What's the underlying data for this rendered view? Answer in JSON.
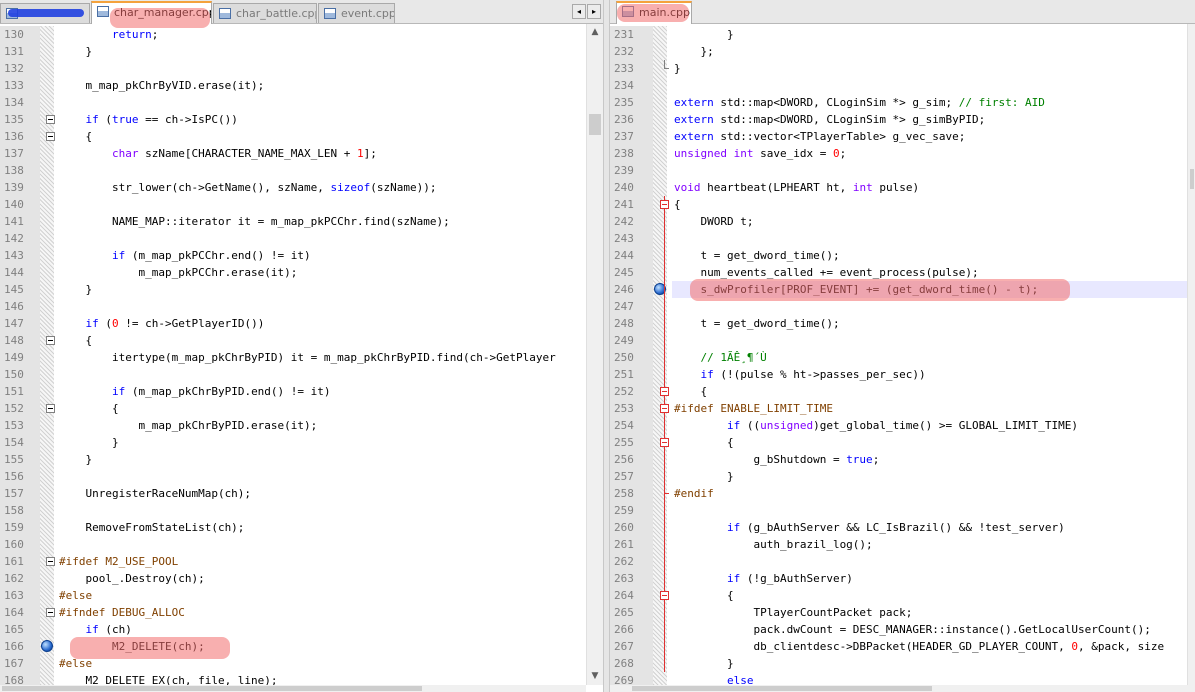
{
  "left_tabs": {
    "tab1": "",
    "tab2": "char_manager.cpp",
    "tab3": "char_battle.cpp",
    "tab4": "event.cpp",
    "nav_left": "◂",
    "nav_right": "▸",
    "close": "✕"
  },
  "right_tabs": {
    "tab1": "main.cpp"
  },
  "left_lines": [
    {
      "n": "130",
      "html": "        <span class=\"kw\">return</span>;"
    },
    {
      "n": "131",
      "html": "    }"
    },
    {
      "n": "132",
      "html": ""
    },
    {
      "n": "133",
      "html": "    m_map_pkChrByVID.erase(it);"
    },
    {
      "n": "134",
      "html": ""
    },
    {
      "n": "135",
      "html": "    <span class=\"kw\">if</span> (<span class=\"kw\">true</span> == ch->IsPC())"
    },
    {
      "n": "136",
      "html": "    {"
    },
    {
      "n": "137",
      "html": "        <span class=\"ty\">char</span> szName[CHARACTER_NAME_MAX_LEN + <span class=\"nm\">1</span>];"
    },
    {
      "n": "138",
      "html": ""
    },
    {
      "n": "139",
      "html": "        str_lower(ch->GetName(), szName, <span class=\"kw\">sizeof</span>(szName));"
    },
    {
      "n": "140",
      "html": ""
    },
    {
      "n": "141",
      "html": "        NAME_MAP::iterator it = m_map_pkPCChr.find(szName);"
    },
    {
      "n": "142",
      "html": ""
    },
    {
      "n": "143",
      "html": "        <span class=\"kw\">if</span> (m_map_pkPCChr.end() != it)"
    },
    {
      "n": "144",
      "html": "            m_map_pkPCChr.erase(it);"
    },
    {
      "n": "145",
      "html": "    }"
    },
    {
      "n": "146",
      "html": ""
    },
    {
      "n": "147",
      "html": "    <span class=\"kw\">if</span> (<span class=\"nm\">0</span> != ch->GetPlayerID())"
    },
    {
      "n": "148",
      "html": "    {"
    },
    {
      "n": "149",
      "html": "        itertype(m_map_pkChrByPID) it = m_map_pkChrByPID.find(ch->GetPlayer"
    },
    {
      "n": "150",
      "html": ""
    },
    {
      "n": "151",
      "html": "        <span class=\"kw\">if</span> (m_map_pkChrByPID.end() != it)"
    },
    {
      "n": "152",
      "html": "        {"
    },
    {
      "n": "153",
      "html": "            m_map_pkChrByPID.erase(it);"
    },
    {
      "n": "154",
      "html": "        }"
    },
    {
      "n": "155",
      "html": "    }"
    },
    {
      "n": "156",
      "html": ""
    },
    {
      "n": "157",
      "html": "    UnregisterRaceNumMap(ch);"
    },
    {
      "n": "158",
      "html": ""
    },
    {
      "n": "159",
      "html": "    RemoveFromStateList(ch);"
    },
    {
      "n": "160",
      "html": ""
    },
    {
      "n": "161",
      "html": "<span class=\"pp\">#ifdef M2_USE_POOL</span>"
    },
    {
      "n": "162",
      "html": "    pool_.Destroy(ch);"
    },
    {
      "n": "163",
      "html": "<span class=\"pp\">#else</span>"
    },
    {
      "n": "164",
      "html": "<span class=\"pp\">#ifndef DEBUG_ALLOC</span>"
    },
    {
      "n": "165",
      "html": "    <span class=\"kw\">if</span> (ch)"
    },
    {
      "n": "166",
      "html": "        M2_DELETE(ch);"
    },
    {
      "n": "167",
      "html": "<span class=\"pp\">#else</span>"
    },
    {
      "n": "168",
      "html": "    M2_DELETE_EX(ch, file, line);"
    }
  ],
  "right_lines": [
    {
      "n": "231",
      "html": "        }"
    },
    {
      "n": "232",
      "html": "    };"
    },
    {
      "n": "233",
      "html": "}"
    },
    {
      "n": "234",
      "html": ""
    },
    {
      "n": "235",
      "html": "<span class=\"kw\">extern</span> std::map&lt;DWORD, CLoginSim *&gt; g_sim; <span class=\"cm\">// first: AID</span>"
    },
    {
      "n": "236",
      "html": "<span class=\"kw\">extern</span> std::map&lt;DWORD, CLoginSim *&gt; g_simByPID;"
    },
    {
      "n": "237",
      "html": "<span class=\"kw\">extern</span> std::vector&lt;TPlayerTable&gt; g_vec_save;"
    },
    {
      "n": "238",
      "html": "<span class=\"ty\">unsigned int</span> save_idx = <span class=\"nm\">0</span>;"
    },
    {
      "n": "239",
      "html": ""
    },
    {
      "n": "240",
      "html": "<span class=\"ty\">void</span> heartbeat(LPHEART ht, <span class=\"ty\">int</span> pulse)"
    },
    {
      "n": "241",
      "html": "{"
    },
    {
      "n": "242",
      "html": "    DWORD t;"
    },
    {
      "n": "243",
      "html": ""
    },
    {
      "n": "244",
      "html": "    t = get_dword_time();"
    },
    {
      "n": "245",
      "html": "    num_events_called += event_process(pulse);"
    },
    {
      "n": "246",
      "html": "    s_dwProfiler[PROF_EVENT] += (get_dword_time() - t);"
    },
    {
      "n": "247",
      "html": ""
    },
    {
      "n": "248",
      "html": "    t = get_dword_time();"
    },
    {
      "n": "249",
      "html": ""
    },
    {
      "n": "250",
      "html": "    <span class=\"cm\">// 1ÃÊ¸¶´Ù</span>"
    },
    {
      "n": "251",
      "html": "    <span class=\"kw\">if</span> (!(pulse % ht->passes_per_sec))"
    },
    {
      "n": "252",
      "html": "    {"
    },
    {
      "n": "253",
      "html": "<span class=\"pp\">#ifdef ENABLE_LIMIT_TIME</span>"
    },
    {
      "n": "254",
      "html": "        <span class=\"kw\">if</span> ((<span class=\"ty\">unsigned</span>)get_global_time() &gt;= GLOBAL_LIMIT_TIME)"
    },
    {
      "n": "255",
      "html": "        {"
    },
    {
      "n": "256",
      "html": "            g_bShutdown = <span class=\"kw\">true</span>;"
    },
    {
      "n": "257",
      "html": "        }"
    },
    {
      "n": "258",
      "html": "<span class=\"pp\">#endif</span>"
    },
    {
      "n": "259",
      "html": ""
    },
    {
      "n": "260",
      "html": "        <span class=\"kw\">if</span> (g_bAuthServer &amp;&amp; LC_IsBrazil() &amp;&amp; !test_server)"
    },
    {
      "n": "261",
      "html": "            auth_brazil_log();"
    },
    {
      "n": "262",
      "html": ""
    },
    {
      "n": "263",
      "html": "        <span class=\"kw\">if</span> (!g_bAuthServer)"
    },
    {
      "n": "264",
      "html": "        {"
    },
    {
      "n": "265",
      "html": "            TPlayerCountPacket pack;"
    },
    {
      "n": "266",
      "html": "            pack.dwCount = DESC_MANAGER::instance().GetLocalUserCount();"
    },
    {
      "n": "267",
      "html": "            db_clientdesc->DBPacket(HEADER_GD_PLAYER_COUNT, <span class=\"nm\">0</span>, &amp;pack, size"
    },
    {
      "n": "268",
      "html": "        }"
    },
    {
      "n": "269",
      "html": "        <span class=\"kw\">else</span>"
    }
  ]
}
